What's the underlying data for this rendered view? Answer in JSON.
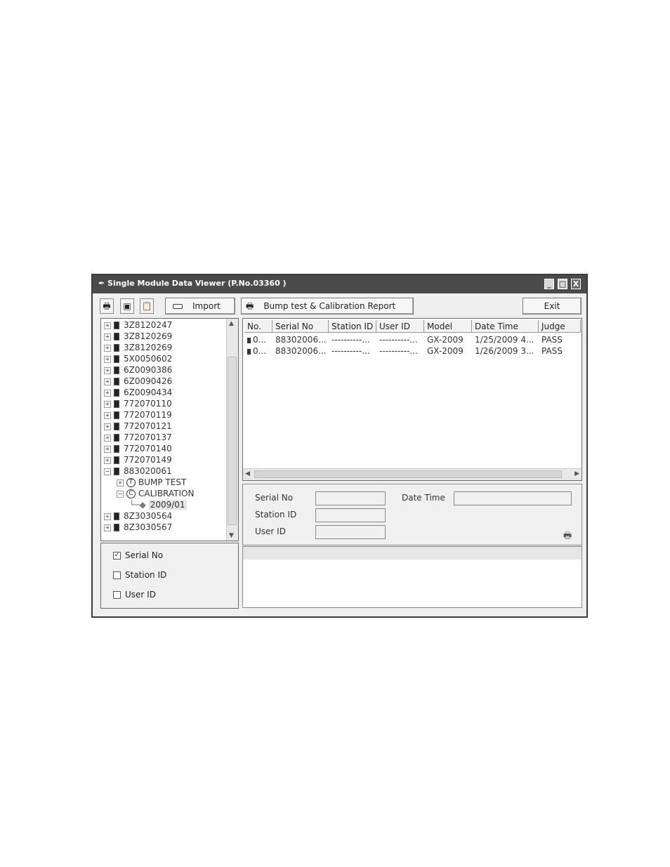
{
  "window": {
    "title": "Single Module Data Viewer (P.No.03360 )",
    "controls": {
      "minimize": "_",
      "maximize": "□",
      "close": "X"
    }
  },
  "toolbar": {
    "icons": [
      "printer-icon",
      "save-icon",
      "clipboard-icon"
    ],
    "import_label": "Import",
    "report_label": "Bump test & Calibration Report",
    "exit_label": "Exit"
  },
  "tree": {
    "items": [
      {
        "label": "3Z8120247"
      },
      {
        "label": "3Z8120269"
      },
      {
        "label": "3Z8120269"
      },
      {
        "label": "5X0050602"
      },
      {
        "label": "6Z0090386"
      },
      {
        "label": "6Z0090426"
      },
      {
        "label": "6Z0090434"
      },
      {
        "label": "772070110"
      },
      {
        "label": "772070119"
      },
      {
        "label": "772070121"
      },
      {
        "label": "772070137"
      },
      {
        "label": "772070140"
      },
      {
        "label": "772070149"
      },
      {
        "label": "883020061"
      },
      {
        "label": "BUMP TEST",
        "badge": "T"
      },
      {
        "label": "CALIBRATION",
        "badge": "C"
      },
      {
        "label": "2009/01"
      },
      {
        "label": "8Z3030564"
      },
      {
        "label": "8Z3030567"
      }
    ]
  },
  "filters": [
    {
      "label": "Serial No",
      "checked": "✓"
    },
    {
      "label": "Station ID",
      "checked": ""
    },
    {
      "label": "User ID",
      "checked": ""
    }
  ],
  "table": {
    "columns": [
      "No.",
      "Serial No",
      "Station ID",
      "User ID",
      "Model",
      "Date Time",
      "Judge"
    ],
    "rows": [
      [
        "0...",
        "88302006...",
        "----------...",
        "----------...",
        "GX-2009",
        "1/25/2009 4...",
        "PASS"
      ],
      [
        "0...",
        "88302006...",
        "----------...",
        "----------...",
        "GX-2009",
        "1/26/2009 3...",
        "PASS"
      ]
    ]
  },
  "detail": {
    "serial_label": "Serial No",
    "station_label": "Station ID",
    "user_label": "User ID",
    "datetime_label": "Date Time"
  }
}
